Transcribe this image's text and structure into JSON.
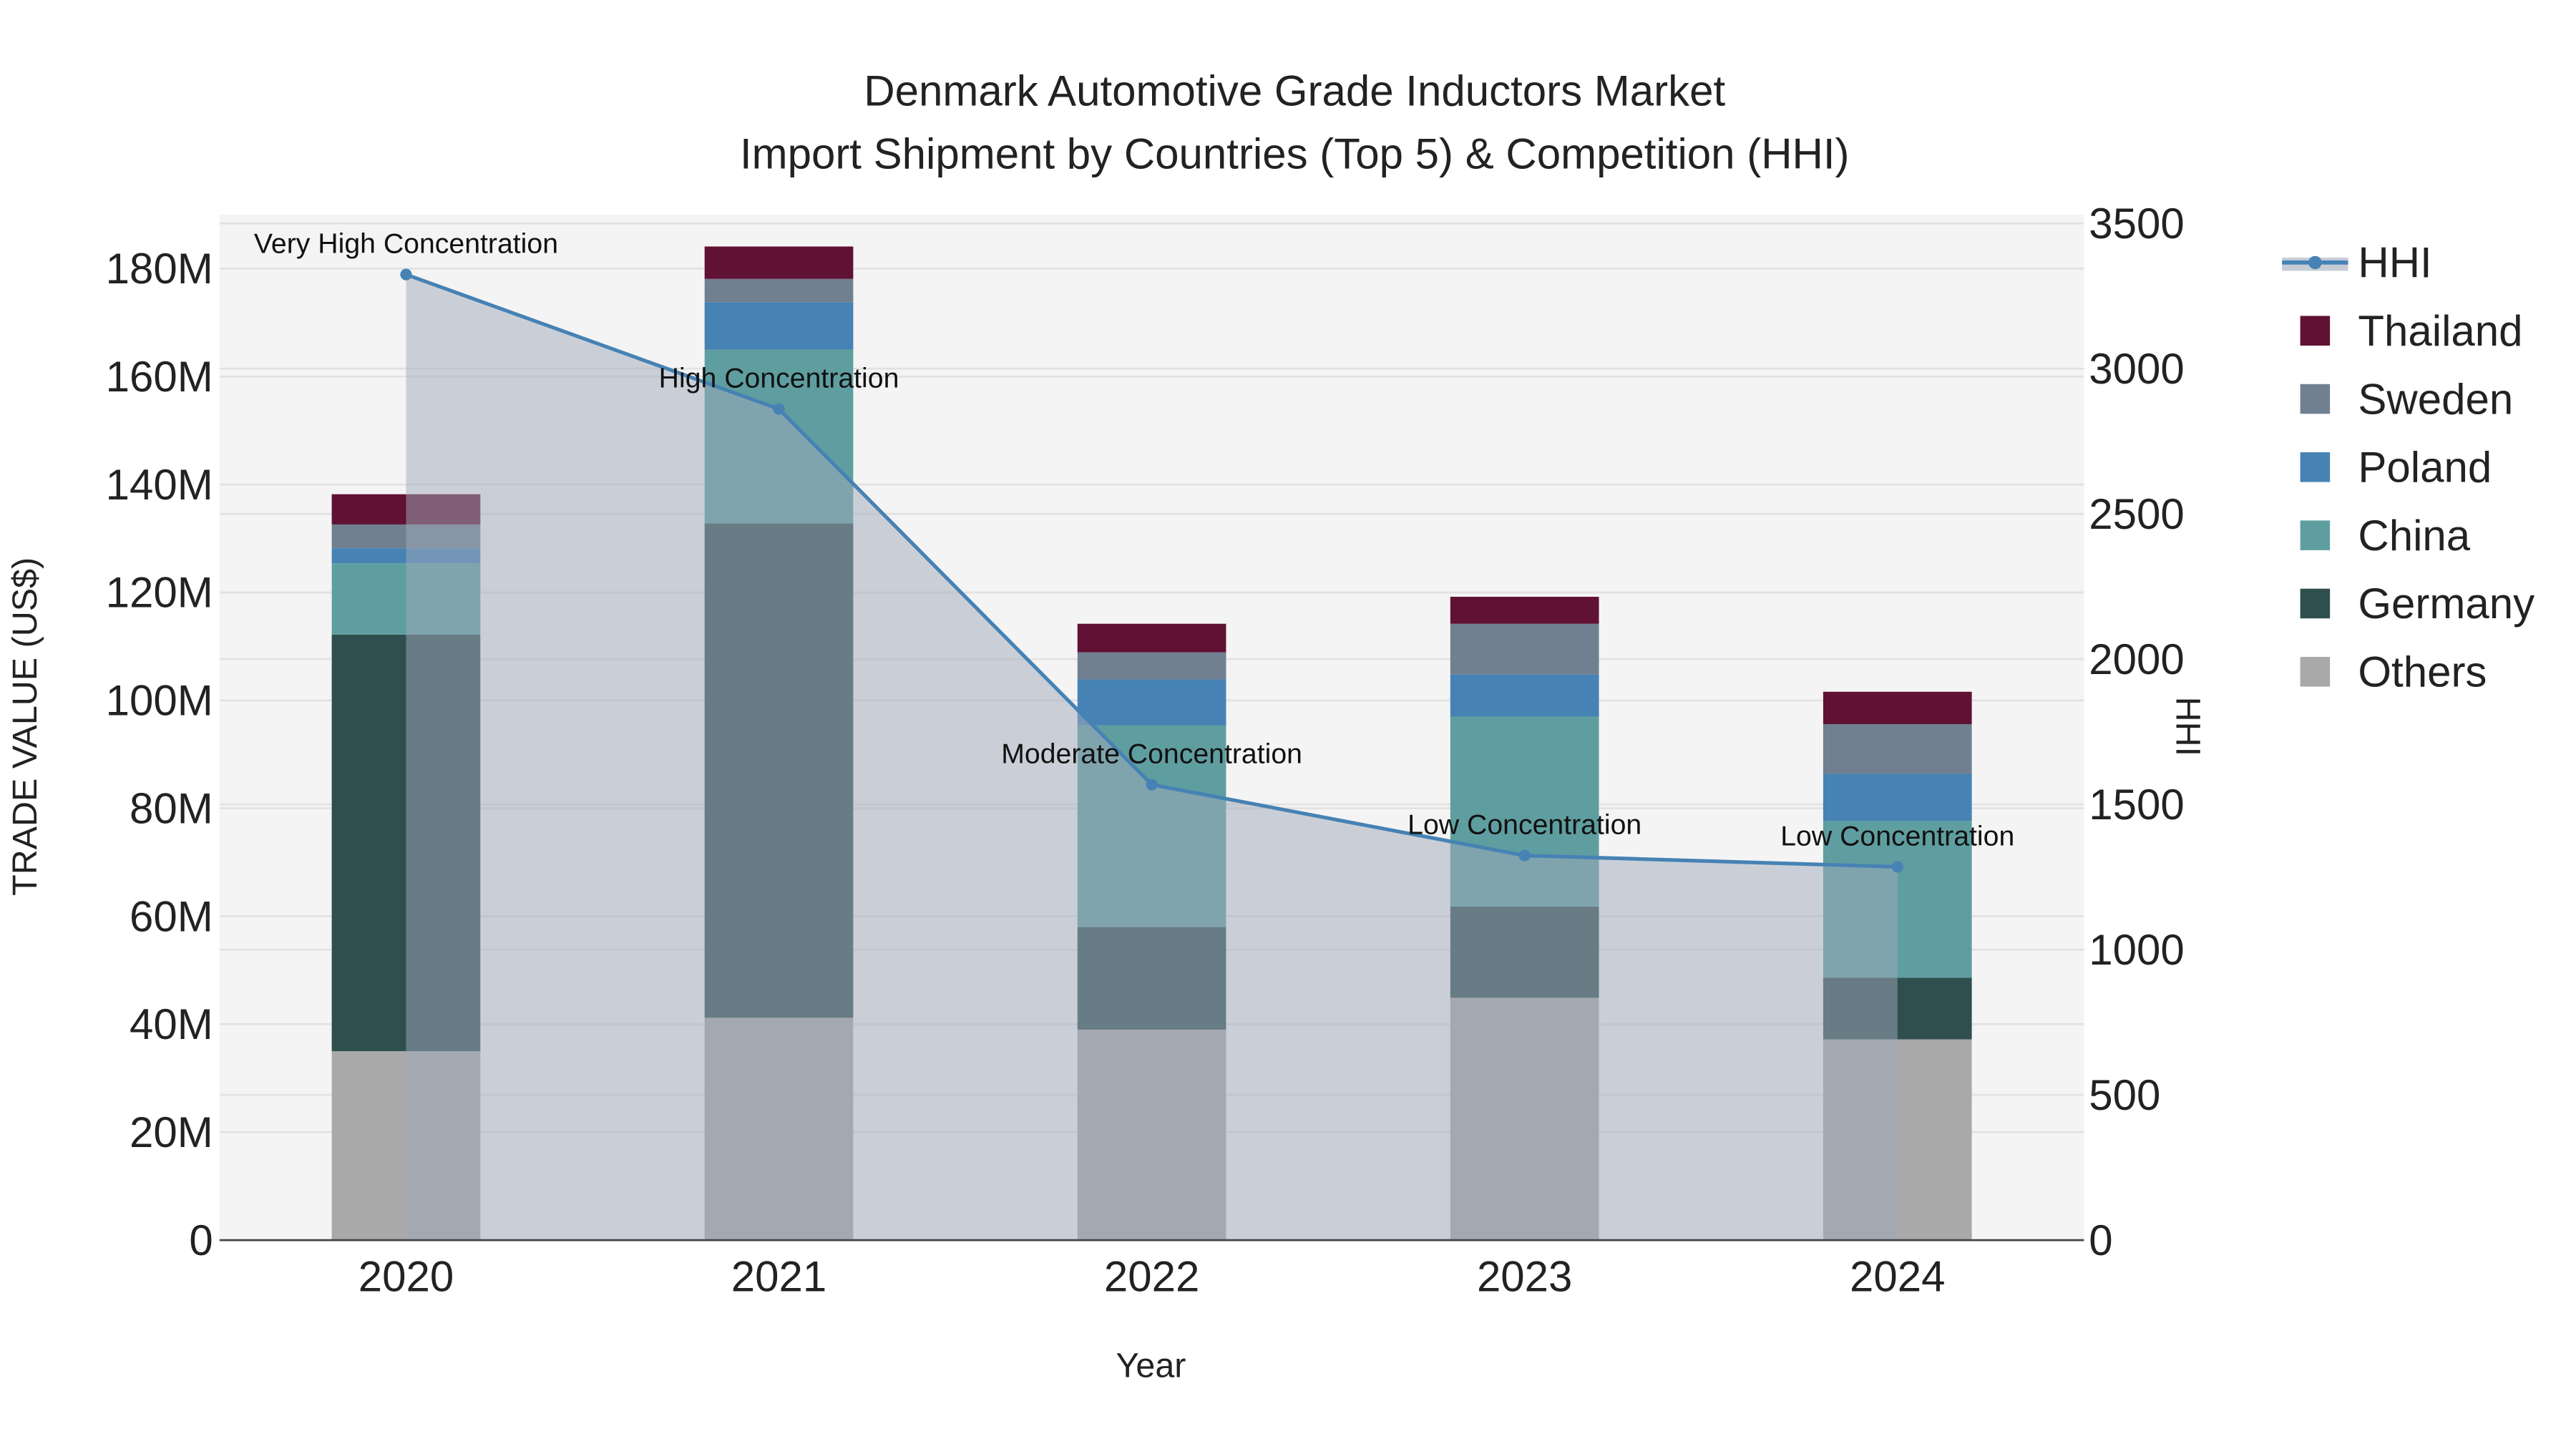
{
  "chart_data": {
    "type": "bar",
    "title": "Denmark Automotive Grade Inductors Market",
    "subtitle": "Import Shipment by Countries (Top 5) & Competition (HHI)",
    "xlabel": "Year",
    "ylabel": "TRADE VALUE (US$)",
    "y2label": "HHI",
    "categories": [
      "2020",
      "2021",
      "2022",
      "2023",
      "2024"
    ],
    "ylim": [
      0,
      190
    ],
    "y_unit": "M",
    "yticks": [
      0,
      20,
      40,
      60,
      80,
      100,
      120,
      140,
      160,
      180
    ],
    "ytick_labels": [
      "0",
      "20M",
      "40M",
      "60M",
      "80M",
      "100M",
      "120M",
      "140M",
      "160M",
      "180M"
    ],
    "y2lim": [
      0,
      3530
    ],
    "y2ticks": [
      "0",
      "500",
      "1000",
      "1500",
      "2000",
      "2500",
      "3000",
      "3500"
    ],
    "grid": true,
    "legend_position": "right",
    "series": [
      {
        "name": "Others",
        "color": "#a9a9a9",
        "values": [
          35.0,
          41.2,
          39.0,
          44.9,
          37.2
        ]
      },
      {
        "name": "Germany",
        "color": "#2f4f4f",
        "values": [
          77.2,
          91.6,
          19.0,
          16.9,
          11.4
        ]
      },
      {
        "name": "China",
        "color": "#5f9ea0",
        "values": [
          13.2,
          32.2,
          37.4,
          35.2,
          29.1
        ]
      },
      {
        "name": "Poland",
        "color": "#4682b4",
        "values": [
          2.8,
          8.8,
          8.5,
          7.8,
          8.7
        ]
      },
      {
        "name": "Sweden",
        "color": "#708090",
        "values": [
          4.4,
          4.3,
          5.0,
          9.4,
          9.2
        ]
      },
      {
        "name": "Thailand",
        "color": "#601234",
        "values": [
          5.6,
          6.0,
          5.3,
          5.0,
          6.0
        ]
      }
    ],
    "hhi": {
      "name": "HHI",
      "color": "#4682b4",
      "values": [
        3324,
        2861,
        1568,
        1324,
        1285
      ],
      "annotations": [
        "Very High Concentration",
        "High Concentration",
        "Moderate Concentration",
        "Low Concentration",
        "Low Concentration"
      ]
    },
    "legend": [
      "HHI",
      "Thailand",
      "Sweden",
      "Poland",
      "China",
      "Germany",
      "Others"
    ]
  }
}
